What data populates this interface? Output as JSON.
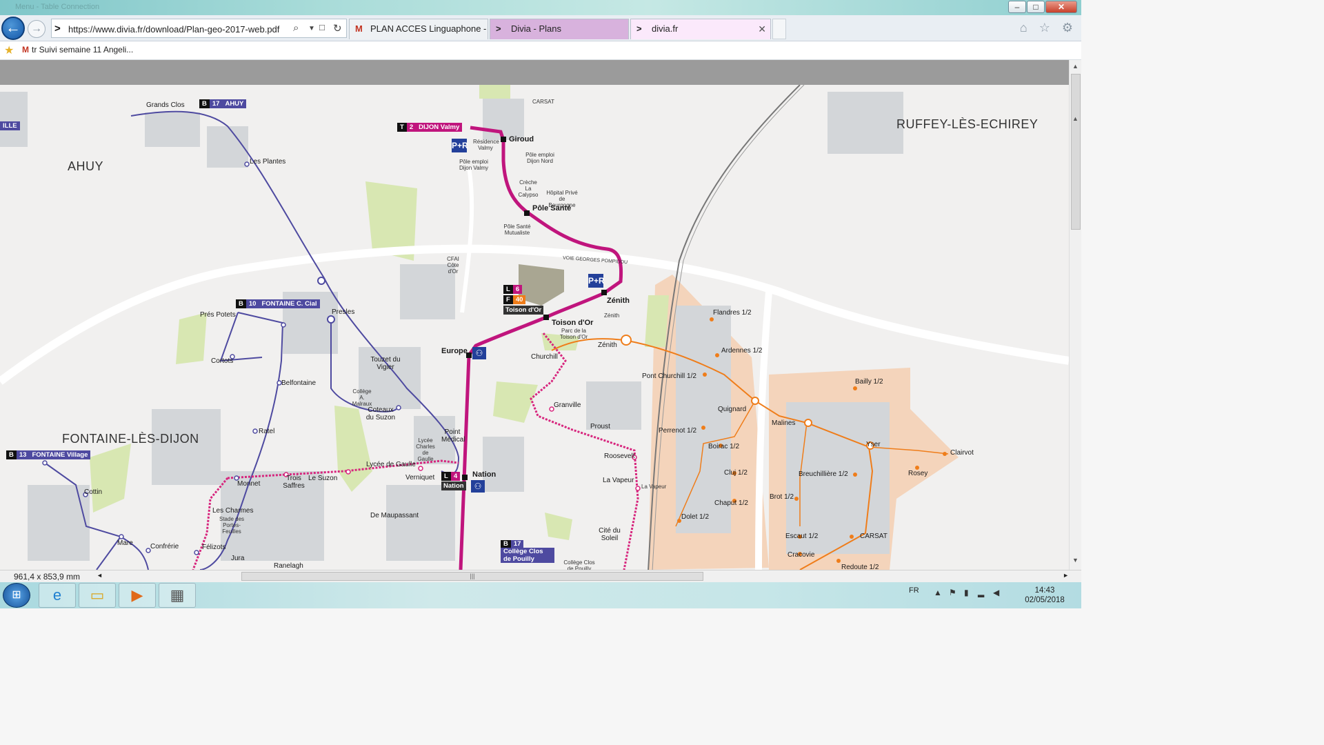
{
  "window": {
    "title_ghost": "Menu - Table Connection",
    "min_label": "–",
    "max_label": "□",
    "close_label": "✕"
  },
  "nav": {
    "back_glyph": "←",
    "forward_glyph": "→",
    "url": "https://www.divia.fr/download/Plan-geo-2017-web.pdf",
    "search_icon": "⌕",
    "lock_icon": "🔒",
    "refresh_icon": "↻",
    "tabs": [
      {
        "label": "PLAN ACCES Linguaphone - cl...",
        "icon": "gmail-icon"
      },
      {
        "label": "Divia - Plans",
        "icon": "divia-icon"
      },
      {
        "label": "divia.fr",
        "icon": "divia-icon",
        "close": "✕"
      }
    ],
    "right_icons": "⌂ ☆ ⚙"
  },
  "favorites": {
    "item": "tr Suivi semaine 11 Angeli..."
  },
  "map": {
    "towns": {
      "ahuy": "AHUY",
      "ruffey": "RUFFEY-LÈS-ECHIREY",
      "fontaine": "FONTAINE-LÈS-DIJON",
      "ille": "ILLE"
    },
    "badges": {
      "b17": {
        "type": "B",
        "num": "17",
        "name": "AHUY"
      },
      "t2": {
        "type": "T",
        "num": "2",
        "name": "DIJON Valmy"
      },
      "b10": {
        "type": "B",
        "num": "10",
        "name": "FONTAINE C. Cial"
      },
      "b13": {
        "type": "B",
        "num": "13",
        "name": "FONTAINE Village"
      },
      "l6": {
        "type": "L",
        "num": "6"
      },
      "f40": {
        "type": "F",
        "num": "40"
      },
      "l4": {
        "type": "L",
        "num": "4"
      },
      "b17b": {
        "type": "B",
        "num": "17",
        "name": "Collège Clos de Pouilly"
      }
    },
    "stops": {
      "grandsclos": "Grands Clos",
      "lesplantes": "Les Plantes",
      "giroud": "Giroud",
      "polesante": "Pôle Santé",
      "zenith": "Zénith",
      "zenith2": "Zénith",
      "toisondor": "Toison d'Or",
      "toisondor_t": "Toison d'Or",
      "europe": "Europe",
      "churchill": "Churchill",
      "granville": "Granville",
      "proust": "Proust",
      "roosevelt": "Roosevelt",
      "lavapeur": "La Vapeur",
      "nation": "Nation",
      "nation_t": "Nation",
      "lycee": "Lycée de Gaulle",
      "verniquet": "Verniquet",
      "lesuzon": "Le Suzon",
      "troissaffres": "Trois Saffres",
      "monnet": "Monnet",
      "lescharmes": "Les Charmes",
      "felizots": "Félizots",
      "jura": "Jura",
      "ranelagh": "Ranelagh",
      "confrerie": "Confrérie",
      "mare": "Mare",
      "cottin": "Cottin",
      "ratel": "Ratel",
      "belfontaine": "Belfontaine",
      "cortots": "Cortots",
      "prespotets": "Prés Potets",
      "presles": "Presles",
      "touzet": "Touzet du Vigier",
      "coteaux": "Coteaux du Suzon",
      "pointmedical": "Point Médical",
      "demaupassant": "De Maupassant",
      "citesoleil": "Cité du Soleil",
      "flandres": "Flandres 1/2",
      "ardennes": "Ardennes 1/2",
      "pontchurchill": "Pont Churchill 1/2",
      "quignard": "Quignard",
      "perrenot": "Perrenot 1/2",
      "boirac": "Boirac 1/2",
      "cluj": "Cluj 1/2",
      "chaput": "Chaput 1/2",
      "dolet": "Dolet 1/2",
      "malines": "Malines",
      "bailly": "Bailly 1/2",
      "yser": "Yser",
      "clairvot": "Clairvot",
      "rosey": "Rosey",
      "breuchilliere": "Breuchillière 1/2",
      "brot": "Brot 1/2",
      "escaut": "Escaut 1/2",
      "carsat": "CARSAT",
      "carsat_top": "CARSAT",
      "cracovie": "Cracovie",
      "redoute": "Redoute 1/2"
    },
    "pois": {
      "residence": "Résidence Valmy",
      "poleemploi_valmy": "Pôle emploi Dijon Valmy",
      "poleemploi_nord": "Pôle emploi Dijon Nord",
      "creche": "Crèche La Calypso",
      "hopital": "Hôpital Privé de Bourgogne",
      "polesante_mut": "Pôle Santé Mutualiste",
      "cfai": "CFAI Côte d'Or",
      "zenith_poi": "Zénith",
      "parc": "Parc de la Toison d'Or",
      "college_malraux": "Collège A. Malraux",
      "lycee_charles": "Lycée Charles de Gaulle",
      "stade": "Stade des Portes-Feuilles",
      "college_pouilly": "Collège Clos de Pouilly",
      "voie": "VOIE GEORGES POMPIDOU",
      "lavapeur_poi": "La Vapeur"
    },
    "icons": {
      "pr": "P+R",
      "bike": "⚇"
    }
  },
  "status": {
    "dims": "961,4 x 853,9 mm",
    "scroll_grip": "|||"
  },
  "taskbar": {
    "lang": "FR",
    "time": "14:43",
    "date": "02/05/2018"
  },
  "colors": {
    "tram": "#c0157d",
    "bus": "#4e4aa0",
    "flexo": "#ef7d1a",
    "industrial": "#f4d4bb",
    "green": "#d8e7b2"
  }
}
